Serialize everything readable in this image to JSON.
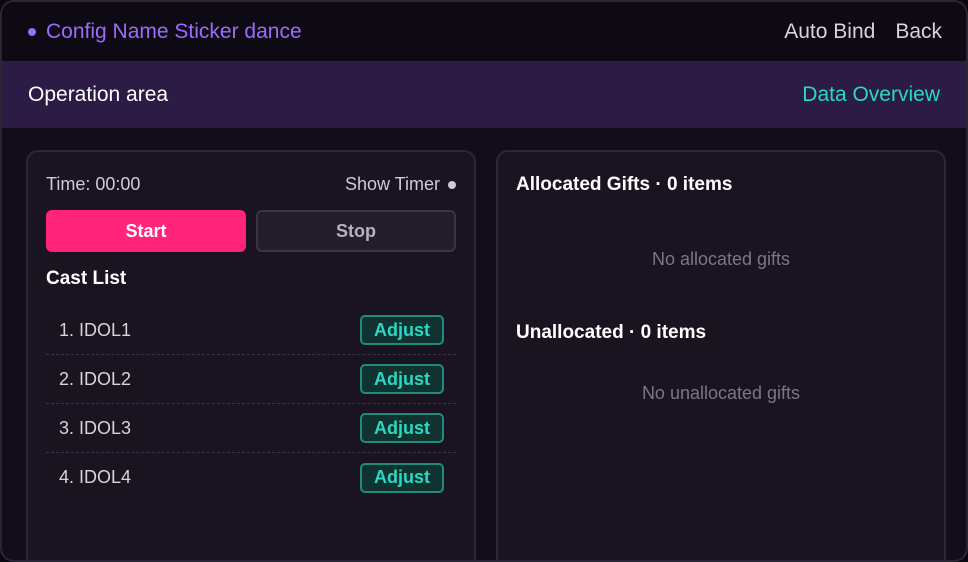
{
  "header": {
    "config_name": "Config Name Sticker dance",
    "auto_bind_label": "Auto Bind",
    "back_label": "Back"
  },
  "operation_bar": {
    "title": "Operation area",
    "data_overview_label": "Data Overview"
  },
  "control_panel": {
    "time_label": "Time: 00:00",
    "show_timer_label": "Show Timer",
    "start_label": "Start",
    "stop_label": "Stop",
    "cast_list_title": "Cast List",
    "cast": [
      {
        "name": "1. IDOL1",
        "action": "Adjust"
      },
      {
        "name": "2. IDOL2",
        "action": "Adjust"
      },
      {
        "name": "3. IDOL3",
        "action": "Adjust"
      },
      {
        "name": "4. IDOL4",
        "action": "Adjust"
      }
    ]
  },
  "gifts_panel": {
    "allocated_title": "Allocated Gifts · 0 items",
    "allocated_empty": "No allocated gifts",
    "unallocated_title": "Unallocated · 0 items",
    "unallocated_empty": "No unallocated gifts"
  },
  "colors": {
    "accent_purple": "#9b6bff",
    "accent_teal": "#29d8c5",
    "start_pink": "#ff2479",
    "op_bar_bg": "#2c1c45"
  }
}
